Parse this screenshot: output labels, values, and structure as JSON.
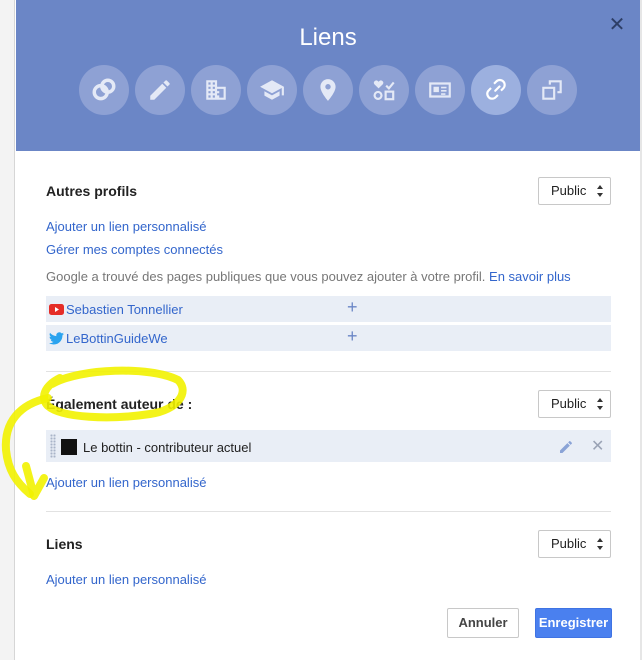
{
  "dialog": {
    "title": "Liens",
    "close_glyph": "✕",
    "nav_icons": [
      {
        "name": "overview-icon"
      },
      {
        "name": "pencil-icon"
      },
      {
        "name": "building-icon"
      },
      {
        "name": "graduation-cap-icon"
      },
      {
        "name": "location-pin-icon"
      },
      {
        "name": "relations-icon"
      },
      {
        "name": "contact-card-icon"
      },
      {
        "name": "link-icon",
        "active": true
      },
      {
        "name": "extra-icon"
      }
    ]
  },
  "other_profiles": {
    "title": "Autres profils",
    "visibility": "Public",
    "add_custom_link": "Ajouter un lien personnalisé",
    "manage_accounts": "Gérer mes comptes connectés",
    "info_text": "Google a trouvé des pages publiques que vous pouvez ajouter à votre profil.",
    "learn_more": "En savoir plus",
    "suggestions": [
      {
        "name": "Sebastien Tonnellier",
        "icon": "youtube-icon",
        "add": "+"
      },
      {
        "name": "LeBottinGuideWe",
        "icon": "twitter-icon",
        "add": "+"
      }
    ]
  },
  "author_of": {
    "title": "Également auteur de :",
    "visibility": "Public",
    "items": [
      {
        "name": "Le bottin - contributeur actuel",
        "remove": "✕"
      }
    ],
    "add_custom_link": "Ajouter un lien personnalisé"
  },
  "links": {
    "title": "Liens",
    "visibility": "Public",
    "add_custom_link": "Ajouter un lien personnalisé"
  },
  "footer": {
    "cancel_label": "Annuler",
    "save_label": "Enregistrer"
  },
  "colors": {
    "header_bg": "#6b86c6",
    "link": "#3366cc",
    "primary_button": "#4a80ef",
    "highlighter_annotation": "#f2f200"
  }
}
